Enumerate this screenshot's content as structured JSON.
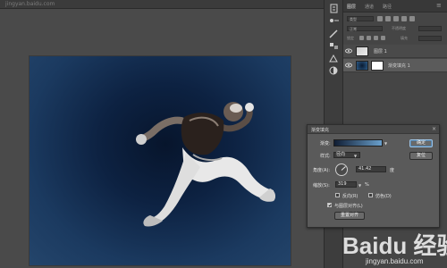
{
  "document_tab": {
    "title": "jingyan.baidu.com"
  },
  "panel": {
    "tabs": [
      "图层",
      "通道",
      "路径"
    ],
    "filter_label": "类型",
    "blend_mode": "正常",
    "opacity_label": "不透明度",
    "lock_label": "锁定",
    "fill_label": "填充",
    "layers": [
      {
        "name": "图层 1",
        "visible": true,
        "selected": false
      },
      {
        "name": "渐变填充 1",
        "visible": true,
        "selected": true
      }
    ]
  },
  "dialog": {
    "title": "渐变填充",
    "close_glyph": "×",
    "gradient_label": "渐变:",
    "gradient_colors": [
      "#101d33",
      "#6aa0cc"
    ],
    "style_label": "样式:",
    "style_value": "径向",
    "angle_label": "角度(A):",
    "angle_value": "41.42",
    "angle_unit": "度",
    "scale_label": "缩放(S):",
    "scale_value": "319",
    "scale_unit": "%",
    "reverse_label": "反向(R)",
    "reverse_checked": false,
    "dither_label": "仿色(D)",
    "dither_checked": false,
    "align_label": "与图层对齐(L)",
    "align_checked": true,
    "reset_alignment_button": "重置对齐",
    "ok_button": "确定",
    "cancel_button": "复位"
  },
  "watermark": {
    "logo_text": "Baidu 经验",
    "url": "jingyan.baidu.com"
  },
  "colors": {
    "accent": "#9cc3e6",
    "canvas_dark": "#07152c",
    "canvas_light": "#24456b"
  }
}
